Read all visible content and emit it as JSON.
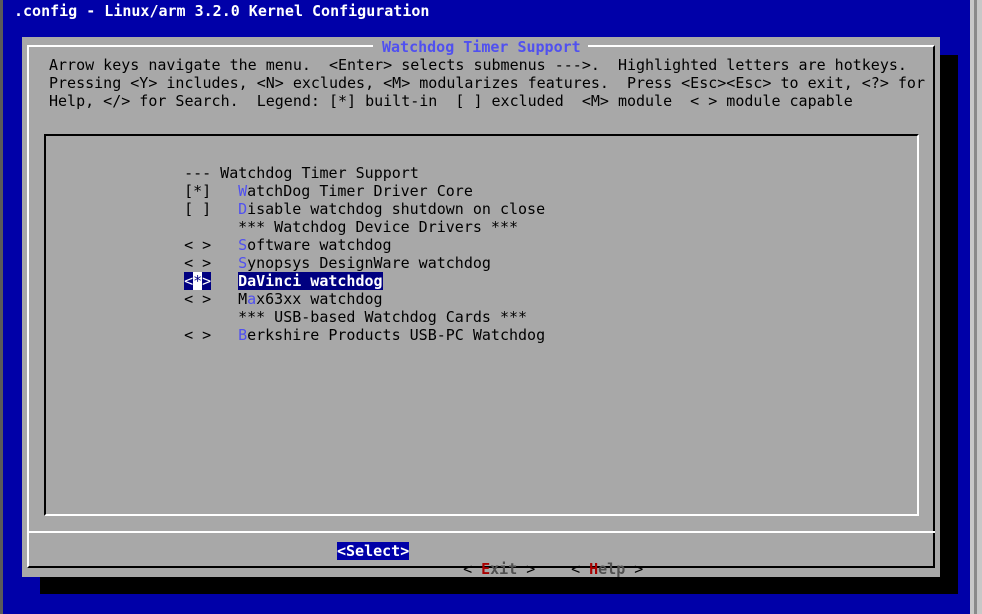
{
  "window": {
    "title": ".config - Linux/arm 3.2.0 Kernel Configuration"
  },
  "dialog": {
    "title": "Watchdog Timer Support",
    "help_lines": [
      "Arrow keys navigate the menu.  <Enter> selects submenus --->.  Highlighted letters are hotkeys.",
      "Pressing <Y> includes, <N> excludes, <M> modularizes features.  Press <Esc><Esc> to exit, <?> for",
      "Help, </> for Search.  Legend: [*] built-in  [ ] excluded  <M> module  < > module capable"
    ]
  },
  "menu": {
    "items": [
      {
        "mark": "",
        "hotkey": "",
        "rest": "--- Watchdog Timer Support",
        "prefix": ""
      },
      {
        "mark": "[*]",
        "hotkey": "W",
        "rest": "atchDog Timer Driver Core"
      },
      {
        "mark": "[ ]",
        "hotkey": "D",
        "rest": "isable watchdog shutdown on close"
      },
      {
        "mark": "",
        "hotkey": "",
        "rest": "*** Watchdog Device Drivers ***"
      },
      {
        "mark": "< >",
        "hotkey": "S",
        "rest": "oftware watchdog"
      },
      {
        "mark": "< >",
        "hotkey": "S",
        "rest": "ynopsys DesignWare watchdog"
      },
      {
        "mark_open": "<",
        "mark_cursor": "*",
        "mark_close": ">",
        "label": "DaVinci watchdog",
        "selected": true
      },
      {
        "mark": "< >",
        "pre": "M",
        "hotkey": "a",
        "rest": "x63xx watchdog"
      },
      {
        "mark": "",
        "hotkey": "",
        "rest": "*** USB-based Watchdog Cards ***"
      },
      {
        "mark": "< >",
        "hotkey": "B",
        "rest": "erkshire Products USB-PC Watchdog"
      }
    ]
  },
  "buttons": {
    "select": "<Select>",
    "exit": {
      "open": "< ",
      "hot": "E",
      "rest": "xit",
      "close": " >"
    },
    "help": {
      "open": "< ",
      "hot": "H",
      "rest": "elp",
      "close": " >"
    }
  },
  "colors": {
    "terminal_bg": "#0000a8",
    "dialog_bg": "#a8a8a8",
    "hotkey": "#5050f0",
    "selection": "#000080",
    "button_hotkey": "#a80000"
  }
}
